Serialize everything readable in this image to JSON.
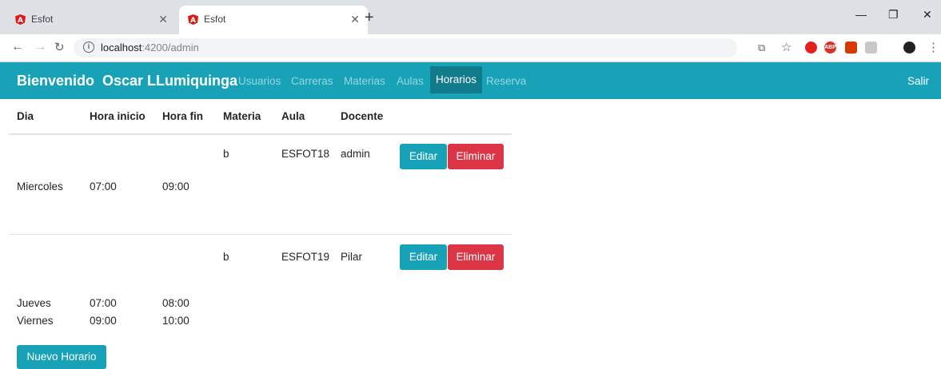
{
  "browser": {
    "tabs": [
      {
        "title": "Esfot",
        "active": false
      },
      {
        "title": "Esfot",
        "active": true
      }
    ],
    "url_host": "localhost",
    "url_path": ":4200/admin"
  },
  "navbar": {
    "brand": "Bienvenido  Oscar LLumiquinga",
    "links": [
      "Usuarios",
      "Carreras",
      "Materias",
      "Aulas",
      "Horarios",
      "Reserva"
    ],
    "active_link": "Horarios",
    "logout": "Salir",
    "color": "#17a2b8"
  },
  "table": {
    "headers": [
      "Dia",
      "Hora inicio",
      "Hora fin",
      "Materia",
      "Aula",
      "Docente"
    ],
    "rows": [
      {
        "dia": "Miercoles",
        "hora_inicio": "07:00",
        "hora_fin": "09:00",
        "materia": "b",
        "aula": "ESFOT18",
        "docente": "admin"
      },
      {
        "dia": "Jueves",
        "hora_inicio": "07:00",
        "hora_fin": "08:00",
        "materia": "b",
        "aula": "ESFOT19",
        "docente": "Pilar"
      },
      {
        "dia": "Viernes",
        "hora_inicio": "09:00",
        "hora_fin": "10:00"
      }
    ],
    "edit_label": "Editar",
    "delete_label": "Eliminar"
  },
  "new_button": "Nuevo Horario"
}
